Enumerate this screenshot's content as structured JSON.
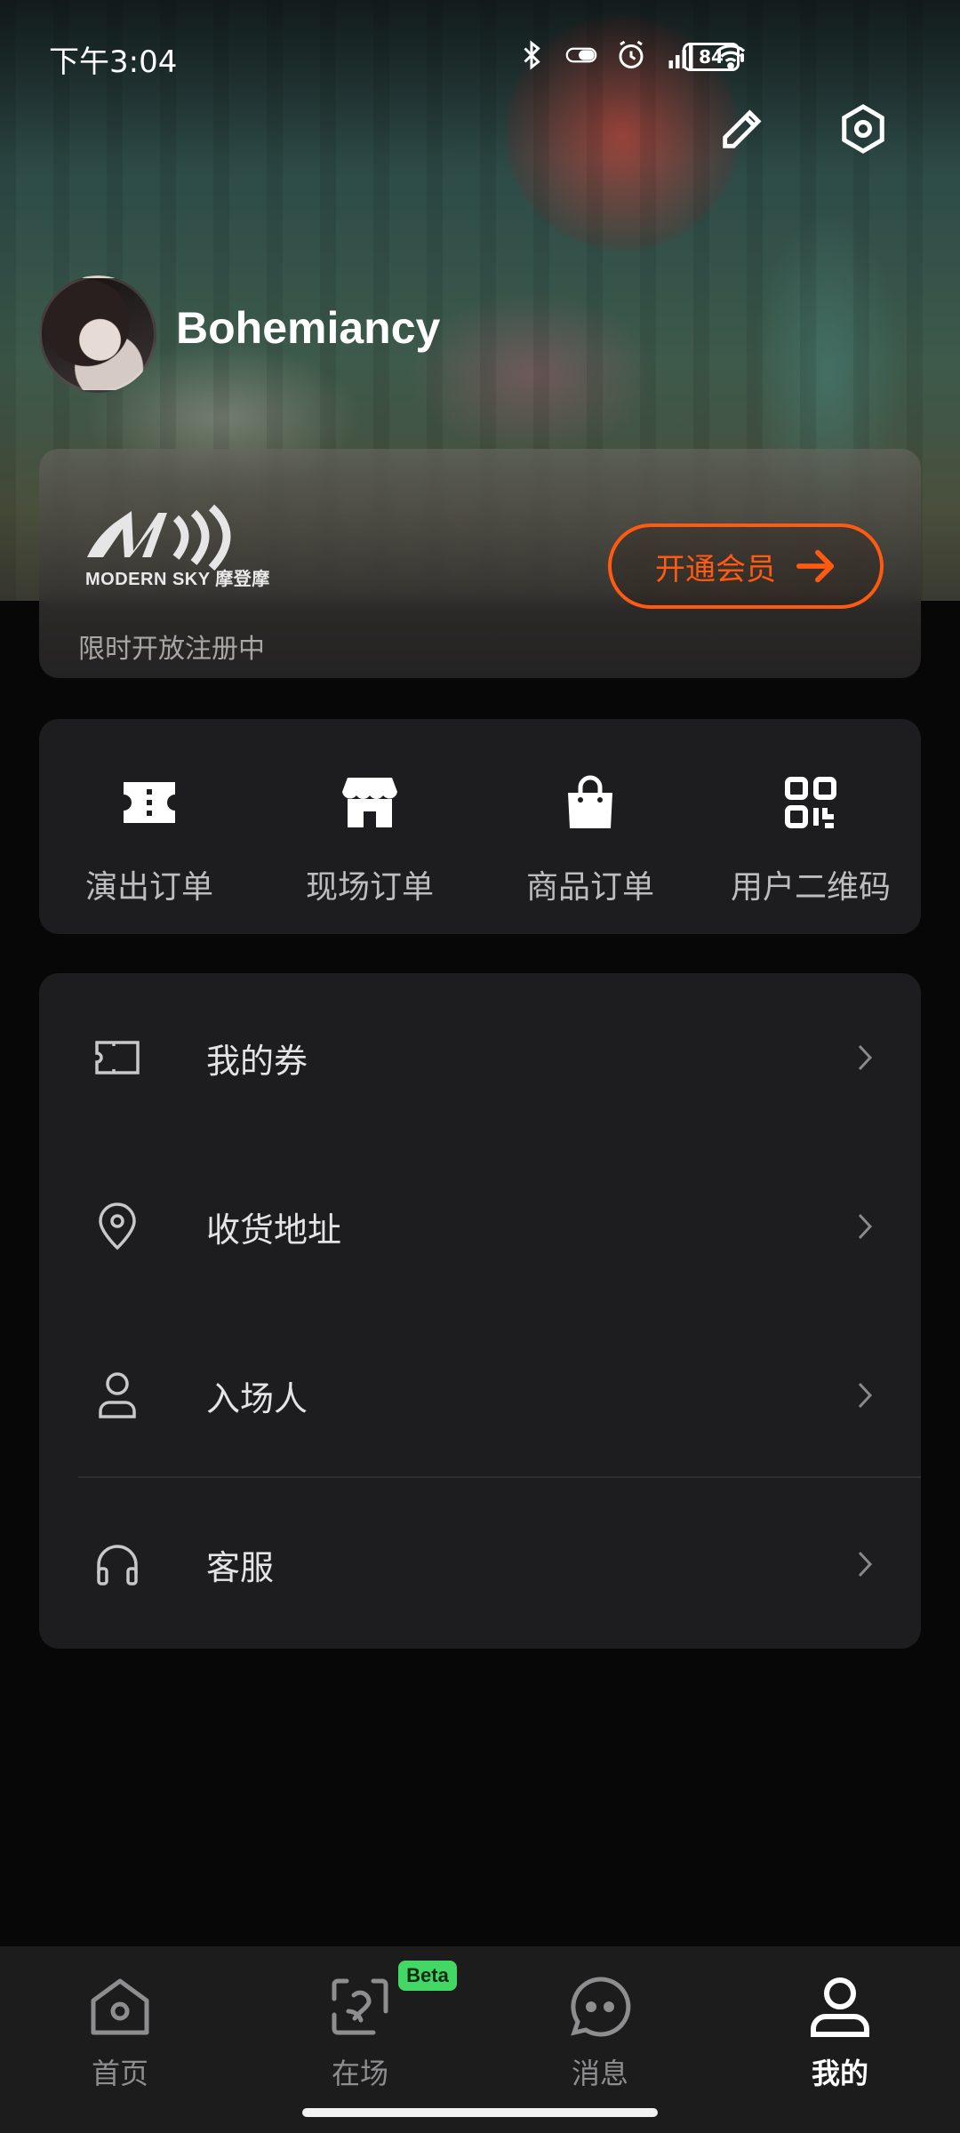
{
  "status_bar": {
    "time": "下午3:04",
    "battery": "84"
  },
  "profile": {
    "username": "Bohemiancy"
  },
  "vip": {
    "logo_text": "MODERN SKY 摩登摩",
    "subtitle": "限时开放注册中",
    "button_label": "开通会员",
    "accent_color": "#ff5a12"
  },
  "orders": [
    {
      "label": "演出订单",
      "icon": "ticket-icon"
    },
    {
      "label": "现场订单",
      "icon": "store-icon"
    },
    {
      "label": "商品订单",
      "icon": "shopping-bag-icon"
    },
    {
      "label": "用户二维码",
      "icon": "qr-code-icon"
    }
  ],
  "menu": [
    {
      "label": "我的券",
      "icon": "coupon-icon"
    },
    {
      "label": "收货地址",
      "icon": "location-pin-icon"
    },
    {
      "label": "入场人",
      "icon": "person-icon"
    },
    {
      "label": "客服",
      "icon": "headphones-icon"
    }
  ],
  "bottom_nav": {
    "items": [
      {
        "label": "首页",
        "icon": "home-icon"
      },
      {
        "label": "在场",
        "icon": "live-scene-icon"
      },
      {
        "label": "消息",
        "icon": "message-icon"
      },
      {
        "label": "我的",
        "icon": "profile-icon"
      }
    ],
    "active": "我的",
    "beta_badge": "Beta",
    "beta_color": "#43d865"
  }
}
